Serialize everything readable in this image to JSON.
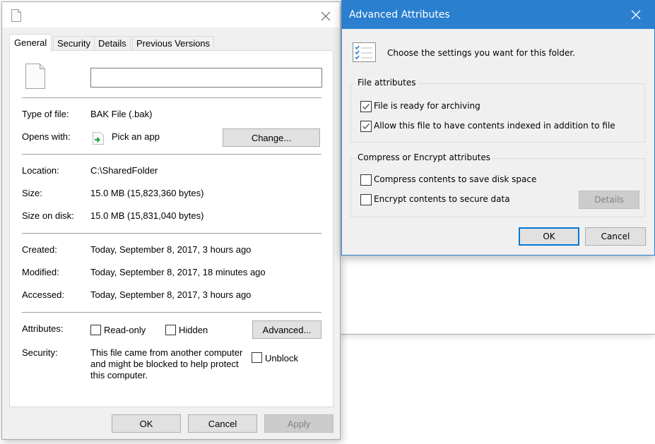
{
  "properties_dialog": {
    "tabs": [
      "General",
      "Security",
      "Details",
      "Previous Versions"
    ],
    "active_tab": "General",
    "file_name_value": "",
    "type_of_file": {
      "label": "Type of file:",
      "value": "BAK File (.bak)"
    },
    "opens_with": {
      "label": "Opens with:",
      "value": "Pick an app",
      "change_button": "Change..."
    },
    "location": {
      "label": "Location:",
      "value": "C:\\SharedFolder"
    },
    "size": {
      "label": "Size:",
      "value": "15.0 MB (15,823,360 bytes)"
    },
    "size_on_disk": {
      "label": "Size on disk:",
      "value": "15.0 MB (15,831,040 bytes)"
    },
    "created": {
      "label": "Created:",
      "value": "Today, September 8, 2017, 3 hours ago"
    },
    "modified": {
      "label": "Modified:",
      "value": "Today, September 8, 2017, 18 minutes ago"
    },
    "accessed": {
      "label": "Accessed:",
      "value": "Today, September 8, 2017, 3 hours ago"
    },
    "attributes": {
      "label": "Attributes:",
      "read_only": {
        "label": "Read-only",
        "checked": false
      },
      "hidden": {
        "label": "Hidden",
        "checked": false
      },
      "advanced_button": "Advanced..."
    },
    "security": {
      "label": "Security:",
      "text": "This file came from another computer and might be blocked to help protect this computer.",
      "unblock": {
        "label": "Unblock",
        "checked": false
      }
    },
    "buttons": {
      "ok": "OK",
      "cancel": "Cancel",
      "apply": "Apply"
    }
  },
  "advanced_dialog": {
    "title": "Advanced Attributes",
    "header_text": "Choose the settings you want for this folder.",
    "file_attributes": {
      "title": "File attributes",
      "archive": {
        "label": "File is ready for archiving",
        "checked": true
      },
      "indexed": {
        "label": "Allow this file to have contents indexed in addition to file",
        "checked": true
      }
    },
    "compress_encrypt": {
      "title": "Compress or Encrypt attributes",
      "compress": {
        "label": "Compress contents to save disk space",
        "checked": false
      },
      "encrypt": {
        "label": "Encrypt contents to secure data",
        "checked": false
      },
      "details_button": "Details"
    },
    "buttons": {
      "ok": "OK",
      "cancel": "Cancel"
    },
    "accent_color": "#2b7fcf"
  }
}
